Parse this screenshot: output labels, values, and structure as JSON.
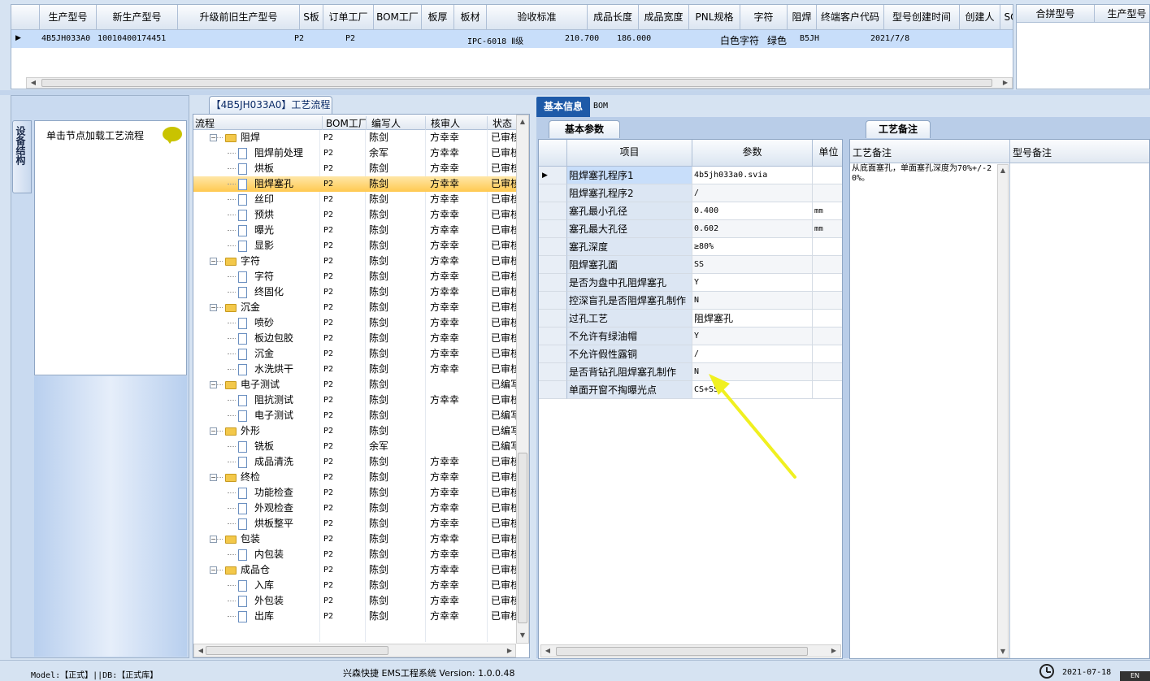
{
  "top_grid": {
    "columns": [
      "生产型号",
      "新生产型号",
      "升级前旧生产型号",
      "S板",
      "订单工厂",
      "BOM工厂",
      "板厚",
      "板材",
      "验收标准",
      "成品长度",
      "成品宽度",
      "PNL规格",
      "字符",
      "阻焊",
      "终端客户代码",
      "型号创建时间",
      "创建人",
      "SO"
    ],
    "row": {
      "model": "4B5JH033A0",
      "new_model": "10010400174451",
      "old_model": "",
      "s_board": "",
      "order_factory": "P2",
      "bom_factory": "P2",
      "thickness": "",
      "material": "",
      "standard": "IPC-6018 Ⅱ级",
      "length": "210.700",
      "width": "186.000",
      "pnl": "",
      "char": "白色字符",
      "mask": "绿色",
      "customer": "B5JH",
      "created": "2021/7/8",
      "creator": "",
      "so": ""
    },
    "right_columns": [
      "合拼型号",
      "生产型号"
    ]
  },
  "left_panel": {
    "tab": "设备结构",
    "hint": "单击节点加载工艺流程"
  },
  "tree": {
    "title": "【4B5JH033A0】工艺流程",
    "columns": [
      "流程",
      "BOM工厂",
      "编写人",
      "核审人",
      "状态"
    ],
    "rows": [
      {
        "type": "folder",
        "name": "阻焊",
        "bom": "P2",
        "writer": "陈剑",
        "checker": "方幸幸",
        "status": "已审核"
      },
      {
        "type": "doc",
        "name": "阻焊前处理",
        "bom": "P2",
        "writer": "余军",
        "checker": "方幸幸",
        "status": "已审核"
      },
      {
        "type": "doc",
        "name": "烘板",
        "bom": "P2",
        "writer": "陈剑",
        "checker": "方幸幸",
        "status": "已审核"
      },
      {
        "type": "doc",
        "name": "阻焊塞孔",
        "bom": "P2",
        "writer": "陈剑",
        "checker": "方幸幸",
        "status": "已审核",
        "selected": true
      },
      {
        "type": "doc",
        "name": "丝印",
        "bom": "P2",
        "writer": "陈剑",
        "checker": "方幸幸",
        "status": "已审核"
      },
      {
        "type": "doc",
        "name": "预烘",
        "bom": "P2",
        "writer": "陈剑",
        "checker": "方幸幸",
        "status": "已审核"
      },
      {
        "type": "doc",
        "name": "曝光",
        "bom": "P2",
        "writer": "陈剑",
        "checker": "方幸幸",
        "status": "已审核"
      },
      {
        "type": "doc",
        "name": "显影",
        "bom": "P2",
        "writer": "陈剑",
        "checker": "方幸幸",
        "status": "已审核"
      },
      {
        "type": "folder",
        "name": "字符",
        "bom": "P2",
        "writer": "陈剑",
        "checker": "方幸幸",
        "status": "已审核"
      },
      {
        "type": "doc",
        "name": "字符",
        "bom": "P2",
        "writer": "陈剑",
        "checker": "方幸幸",
        "status": "已审核"
      },
      {
        "type": "doc",
        "name": "终固化",
        "bom": "P2",
        "writer": "陈剑",
        "checker": "方幸幸",
        "status": "已审核"
      },
      {
        "type": "folder",
        "name": "沉金",
        "bom": "P2",
        "writer": "陈剑",
        "checker": "方幸幸",
        "status": "已审核"
      },
      {
        "type": "doc",
        "name": "喷砂",
        "bom": "P2",
        "writer": "陈剑",
        "checker": "方幸幸",
        "status": "已审核"
      },
      {
        "type": "doc",
        "name": "板边包胶",
        "bom": "P2",
        "writer": "陈剑",
        "checker": "方幸幸",
        "status": "已审核"
      },
      {
        "type": "doc",
        "name": "沉金",
        "bom": "P2",
        "writer": "陈剑",
        "checker": "方幸幸",
        "status": "已审核"
      },
      {
        "type": "doc",
        "name": "水洗烘干",
        "bom": "P2",
        "writer": "陈剑",
        "checker": "方幸幸",
        "status": "已审核"
      },
      {
        "type": "folder",
        "name": "电子测试",
        "bom": "P2",
        "writer": "陈剑",
        "checker": "",
        "status": "已编写"
      },
      {
        "type": "doc",
        "name": "阻抗测试",
        "bom": "P2",
        "writer": "陈剑",
        "checker": "方幸幸",
        "status": "已审核"
      },
      {
        "type": "doc",
        "name": "电子测试",
        "bom": "P2",
        "writer": "陈剑",
        "checker": "",
        "status": "已编写"
      },
      {
        "type": "folder",
        "name": "外形",
        "bom": "P2",
        "writer": "陈剑",
        "checker": "",
        "status": "已编写"
      },
      {
        "type": "doc",
        "name": "铣板",
        "bom": "P2",
        "writer": "余军",
        "checker": "",
        "status": "已编写"
      },
      {
        "type": "doc",
        "name": "成品清洗",
        "bom": "P2",
        "writer": "陈剑",
        "checker": "方幸幸",
        "status": "已审核"
      },
      {
        "type": "folder",
        "name": "终检",
        "bom": "P2",
        "writer": "陈剑",
        "checker": "方幸幸",
        "status": "已审核"
      },
      {
        "type": "doc",
        "name": "功能检查",
        "bom": "P2",
        "writer": "陈剑",
        "checker": "方幸幸",
        "status": "已审核"
      },
      {
        "type": "doc",
        "name": "外观检查",
        "bom": "P2",
        "writer": "陈剑",
        "checker": "方幸幸",
        "status": "已审核"
      },
      {
        "type": "doc",
        "name": "烘板整平",
        "bom": "P2",
        "writer": "陈剑",
        "checker": "方幸幸",
        "status": "已审核"
      },
      {
        "type": "folder",
        "name": "包装",
        "bom": "P2",
        "writer": "陈剑",
        "checker": "方幸幸",
        "status": "已审核"
      },
      {
        "type": "doc",
        "name": "内包装",
        "bom": "P2",
        "writer": "陈剑",
        "checker": "方幸幸",
        "status": "已审核"
      },
      {
        "type": "folder",
        "name": "成品仓",
        "bom": "P2",
        "writer": "陈剑",
        "checker": "方幸幸",
        "status": "已审核"
      },
      {
        "type": "doc",
        "name": "入库",
        "bom": "P2",
        "writer": "陈剑",
        "checker": "方幸幸",
        "status": "已审核"
      },
      {
        "type": "doc",
        "name": "外包装",
        "bom": "P2",
        "writer": "陈剑",
        "checker": "方幸幸",
        "status": "已审核"
      },
      {
        "type": "doc",
        "name": "出库",
        "bom": "P2",
        "writer": "陈剑",
        "checker": "方幸幸",
        "status": "已审核"
      }
    ]
  },
  "info_tabs": {
    "basic": "基本信息",
    "bom": "BOM"
  },
  "params": {
    "tab": "基本参数",
    "columns": [
      "项目",
      "参数",
      "单位"
    ],
    "rows": [
      {
        "item": "阻焊塞孔程序1",
        "value": "4b5jh033a0.svia",
        "unit": ""
      },
      {
        "item": "阻焊塞孔程序2",
        "value": "/",
        "unit": ""
      },
      {
        "item": "塞孔最小孔径",
        "value": "0.400",
        "unit": "mm"
      },
      {
        "item": "塞孔最大孔径",
        "value": "0.602",
        "unit": "mm"
      },
      {
        "item": "塞孔深度",
        "value": "≥80%",
        "unit": ""
      },
      {
        "item": "阻焊塞孔面",
        "value": "SS",
        "unit": ""
      },
      {
        "item": "是否为盘中孔阻焊塞孔",
        "value": "Y",
        "unit": ""
      },
      {
        "item": "控深盲孔是否阻焊塞孔制作",
        "value": "N",
        "unit": ""
      },
      {
        "item": "过孔工艺",
        "value": "阻焊塞孔",
        "unit": ""
      },
      {
        "item": "不允许有绿油帽",
        "value": "Y",
        "unit": ""
      },
      {
        "item": "不允许假性露铜",
        "value": "/",
        "unit": ""
      },
      {
        "item": "是否背钻孔阻焊塞孔制作",
        "value": "N",
        "unit": ""
      },
      {
        "item": "单面开窗不掏曝光点",
        "value": "CS+SS",
        "unit": ""
      }
    ]
  },
  "remarks": {
    "tab": "工艺备注",
    "col1": "工艺备注",
    "col2": "型号备注",
    "text": "从底面塞孔，单面塞孔深度为70%+/-20%。"
  },
  "status": {
    "left": "Model:【正式】||DB:【正式库】",
    "center": "兴森快捷 EMS工程系统 Version: 1.0.0.48",
    "date": "2021-07-18",
    "lang": "EN"
  },
  "colors": {
    "selected_row": "#c8defa",
    "tree_selected": "#ffd070",
    "arrow": "#f0f020",
    "tab_active": "#1e5aa8"
  }
}
